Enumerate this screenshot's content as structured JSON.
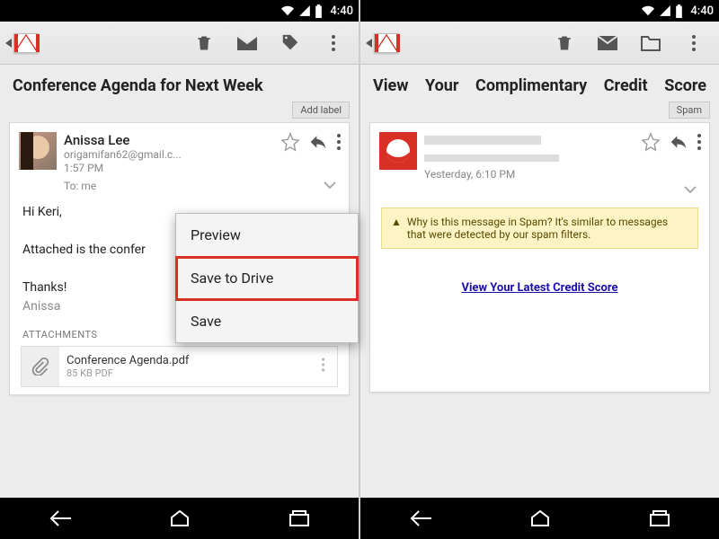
{
  "status": {
    "time": "4:40"
  },
  "left": {
    "subject": "Conference Agenda for Next Week",
    "add_label": "Add label",
    "sender": {
      "name": "Anissa Lee",
      "email": "origamifan62@gmail.c...",
      "time": "1:57 PM",
      "to": "To: me"
    },
    "body": {
      "greeting": "Hi Keri,",
      "line": "Attached is the confer",
      "thanks": "Thanks!",
      "sig": "Anissa"
    },
    "attachments_header": "ATTACHMENTS",
    "attachment": {
      "filename": "Conference Agenda.pdf",
      "meta": "85 KB PDF"
    },
    "popup": {
      "preview": "Preview",
      "save_drive": "Save to Drive",
      "save": "Save"
    }
  },
  "right": {
    "subject": "View Your Complimentary Credit Score",
    "spam_label": "Spam",
    "sender": {
      "time": "Yesterday, 6:10 PM"
    },
    "spam_banner": "Why is this message in Spam? It's similar to messages that were detected by our spam filters.",
    "link_text": "View Your Latest Credit Score"
  }
}
